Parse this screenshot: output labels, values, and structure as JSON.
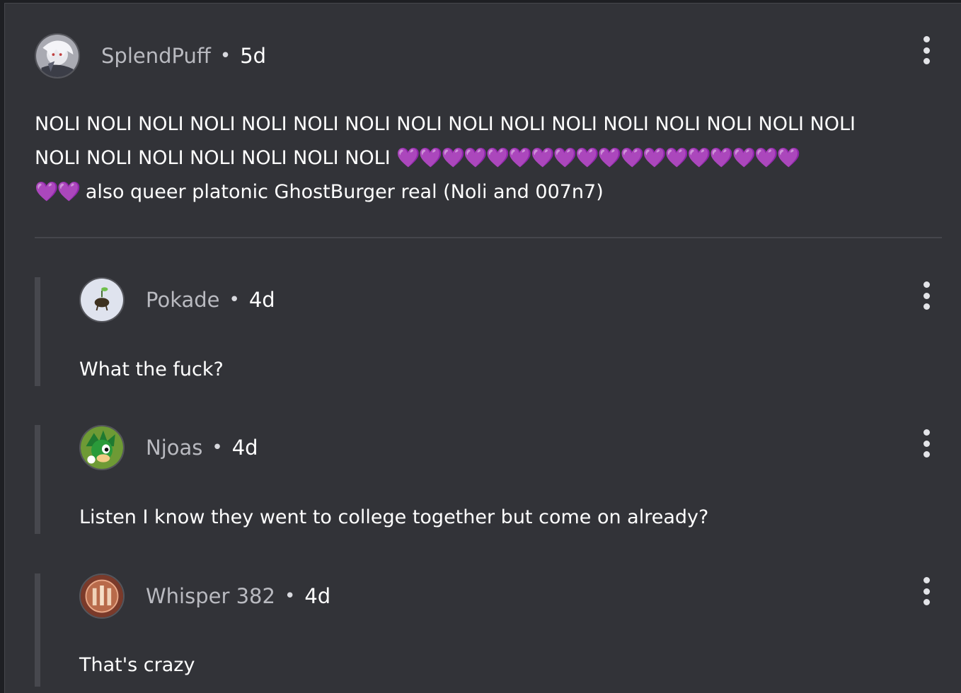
{
  "post": {
    "author": "SplendPuff",
    "separator": "•",
    "time": "5d",
    "body_line1": "NOLI NOLI NOLI NOLI NOLI NOLI NOLI NOLI NOLI NOLI NOLI NOLI NOLI NOLI NOLI NOLI",
    "body_line2_text": "NOLI NOLI NOLI NOLI NOLI NOLI NOLI ",
    "body_line2_hearts": "💜💜💜💜💜💜💜💜💜💜💜💜💜💜💜💜💜💜",
    "body_line3_hearts": "💜💜",
    "body_line3_text": " also queer platonic GhostBurger real (Noli and 007n7)",
    "avatar_icon": "avatar-image",
    "more_icon": "kebab-menu-icon"
  },
  "replies": [
    {
      "author": "Pokade",
      "separator": "•",
      "time": "4d",
      "body": "What the fuck?"
    },
    {
      "author": "Njoas",
      "separator": "•",
      "time": "4d",
      "body": "Listen I know they went to college together but come on already?"
    },
    {
      "author": "Whisper 382",
      "separator": "•",
      "time": "4d",
      "body": "That's crazy"
    }
  ],
  "colors": {
    "background": "#323338",
    "divider": "#45464c",
    "author_text": "#b9bac0",
    "heart": "#a23fe0"
  }
}
